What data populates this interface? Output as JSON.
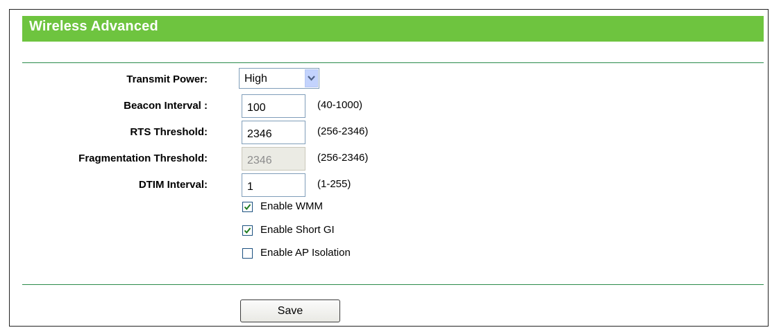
{
  "header": {
    "title": "Wireless Advanced"
  },
  "form": {
    "transmit_power": {
      "label": "Transmit Power:",
      "value": "High"
    },
    "beacon_interval": {
      "label": "Beacon Interval :",
      "value": "100",
      "range": "(40-1000)"
    },
    "rts_threshold": {
      "label": "RTS Threshold:",
      "value": "2346",
      "range": "(256-2346)"
    },
    "fragmentation_threshold": {
      "label": "Fragmentation Threshold:",
      "value": "2346",
      "range": "(256-2346)",
      "disabled": true
    },
    "dtim_interval": {
      "label": "DTIM Interval:",
      "value": "1",
      "range": "(1-255)"
    },
    "checkboxes": [
      {
        "label": "Enable WMM",
        "checked": true
      },
      {
        "label": "Enable Short GI",
        "checked": true
      },
      {
        "label": "Enable AP Isolation",
        "checked": false
      }
    ],
    "save_label": "Save"
  },
  "colors": {
    "header_bg": "#6ec43f",
    "divider": "#2a8a4a",
    "checkmark": "#1e7b1e"
  },
  "icons": {
    "dropdown": "chevron-down-icon",
    "check": "checkmark-icon"
  }
}
